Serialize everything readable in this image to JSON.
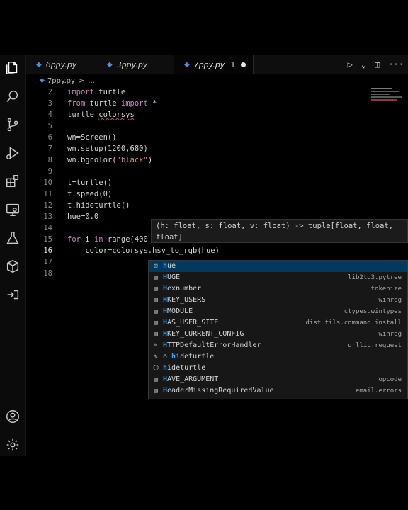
{
  "tabs": [
    {
      "label": "6ppy.py",
      "active": false
    },
    {
      "label": "3ppy.py",
      "active": false
    },
    {
      "label": "7ppy.py",
      "active": true,
      "problem_count": "1"
    }
  ],
  "breadcrumb": {
    "file": "7ppy.py",
    "sep": ">",
    "rest": "..."
  },
  "lines": [
    {
      "n": "2",
      "tokens": [
        [
          "kw",
          "import"
        ],
        [
          "plain",
          " turtle"
        ]
      ]
    },
    {
      "n": "3",
      "tokens": [
        [
          "kw",
          "from"
        ],
        [
          "plain",
          " turtle "
        ],
        [
          "kw",
          "import"
        ],
        [
          "plain",
          " *"
        ]
      ]
    },
    {
      "n": "4",
      "tokens": [
        [
          "plain",
          "turtle "
        ],
        [
          "squig",
          "colorsys"
        ]
      ]
    },
    {
      "n": "5",
      "tokens": []
    },
    {
      "n": "6",
      "tokens": [
        [
          "plain",
          "wn=Screen()"
        ]
      ]
    },
    {
      "n": "7",
      "tokens": [
        [
          "plain",
          "wn.setup(1200,680)"
        ]
      ]
    },
    {
      "n": "8",
      "tokens": [
        [
          "plain",
          "wn.bgcolor("
        ],
        [
          "str",
          "\"black\""
        ],
        [
          "plain",
          ")"
        ]
      ]
    },
    {
      "n": "9",
      "tokens": []
    },
    {
      "n": "10",
      "tokens": [
        [
          "plain",
          "t=turtle()"
        ]
      ]
    },
    {
      "n": "11",
      "tokens": [
        [
          "plain",
          "t.speed(0)"
        ]
      ]
    },
    {
      "n": "12",
      "tokens": [
        [
          "plain",
          "t.hideturtle()"
        ]
      ]
    },
    {
      "n": "13",
      "tokens": [
        [
          "plain",
          "hue=0.0"
        ]
      ]
    },
    {
      "n": "14",
      "tokens": []
    },
    {
      "n": "15",
      "tokens": [
        [
          "kw",
          "for"
        ],
        [
          "plain",
          " i "
        ],
        [
          "kw",
          "in"
        ],
        [
          "plain",
          " range(400"
        ]
      ]
    },
    {
      "n": "16",
      "tokens": [
        [
          "plain",
          "    color=colorsys.hsv_to_rgb(hue)"
        ]
      ]
    },
    {
      "n": "17",
      "tokens": []
    },
    {
      "n": "18",
      "tokens": []
    }
  ],
  "signature_help": {
    "line1": "(h: float, s: float, v: float) -> tuple[float, float,",
    "line2": "float]"
  },
  "suggestions": [
    {
      "icon": "variable",
      "label": "hue",
      "source": ""
    },
    {
      "icon": "module",
      "label": "HUGE",
      "source": "lib2to3.pytree"
    },
    {
      "icon": "module",
      "label": "Hexnumber",
      "source": "tokenize"
    },
    {
      "icon": "module",
      "label": "HKEY_USERS",
      "source": "winreg"
    },
    {
      "icon": "module",
      "label": "HMODULE",
      "source": "ctypes.wintypes"
    },
    {
      "icon": "module",
      "label": "HAS_USER_SITE",
      "source": "distutils.command.install"
    },
    {
      "icon": "module",
      "label": "HKEY_CURRENT_CONFIG",
      "source": "winreg"
    },
    {
      "icon": "wrench",
      "label": "HTTPDefaultErrorHandler",
      "source": "urllib.request"
    },
    {
      "icon": "wrench",
      "label": "o hideturtle",
      "source": ""
    },
    {
      "icon": "cube",
      "label": "hideturtle",
      "source": ""
    },
    {
      "icon": "module",
      "label": "HAVE_ARGUMENT",
      "source": "opcode"
    },
    {
      "icon": "module",
      "label": "HeaderMissingRequiredValue",
      "source": "email.errors"
    }
  ],
  "activity_icons": [
    "files-icon",
    "search-icon",
    "source-control-icon",
    "run-debug-icon",
    "extensions-icon",
    "remote-explorer-icon",
    "testing-icon",
    "box-icon",
    "share-icon",
    "account-icon",
    "settings-gear-icon"
  ]
}
